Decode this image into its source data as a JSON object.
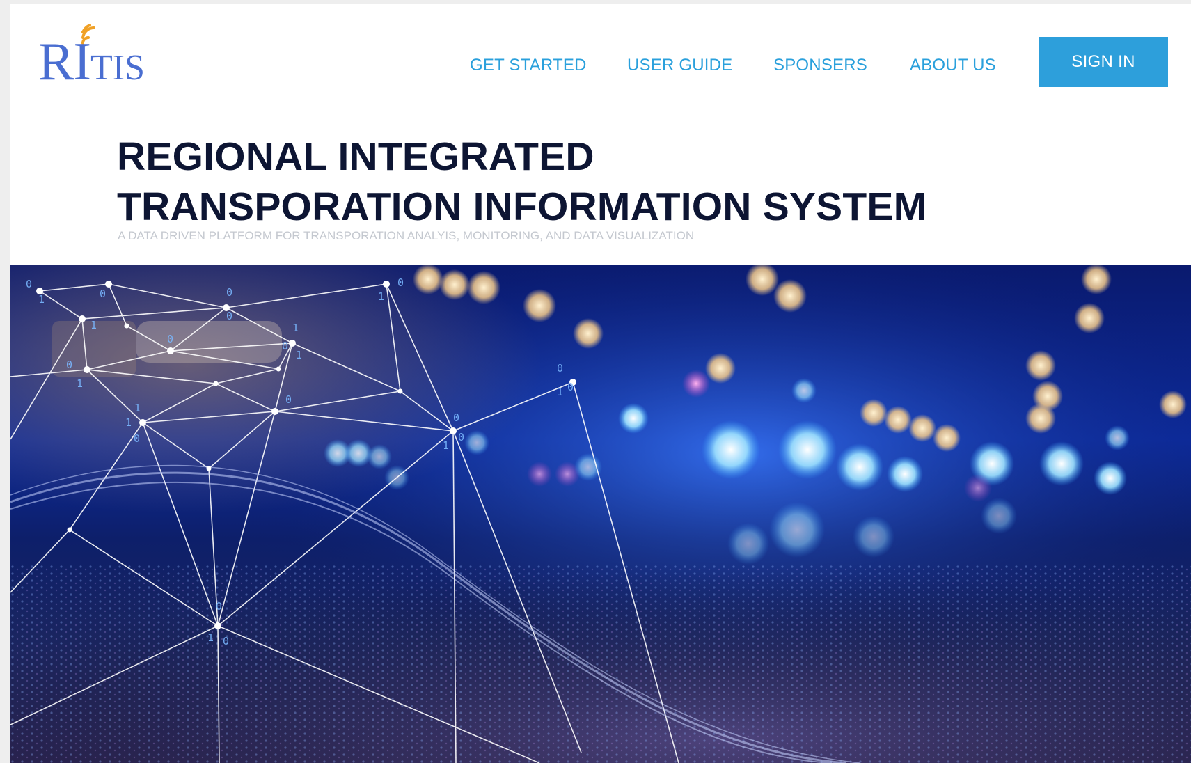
{
  "brand": {
    "logo_text": "RITIS",
    "logo_color": "#4a6ed1",
    "logo_accent_color": "#f0a126"
  },
  "nav": {
    "items": [
      {
        "label": "GET STARTED"
      },
      {
        "label": "USER GUIDE"
      },
      {
        "label": "SPONSERS"
      },
      {
        "label": "ABOUT US"
      }
    ],
    "link_color": "#2aa0dc"
  },
  "auth": {
    "sign_in_label": "SIGN IN",
    "button_color": "#2d9fdb"
  },
  "hero": {
    "title_line1": "REGIONAL INTEGRATED",
    "title_line2": "TRANSPORATION INFORMATION SYSTEM",
    "subtitle": "A DATA DRIVEN PLATFORM FOR TRANSPORATION ANALYIS, MONITORING, AND DATA VISUALIZATION",
    "title_color": "#0d1533",
    "image_icon": "night-street-network-image"
  }
}
